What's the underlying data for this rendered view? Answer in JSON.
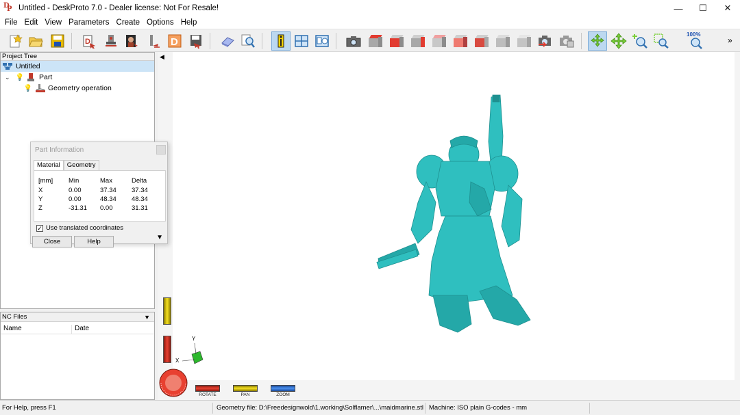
{
  "window": {
    "title": "Untitled - DeskProto 7.0 - Dealer license: Not For Resale!",
    "minimize": "—",
    "maximize": "☐",
    "close": "✕"
  },
  "menu": [
    "File",
    "Edit",
    "View",
    "Parameters",
    "Create",
    "Options",
    "Help"
  ],
  "toolbar": {
    "zoom_label": "100%",
    "overflow": "»"
  },
  "project_tree": {
    "title": "Project Tree",
    "items": [
      {
        "label": "Untitled"
      },
      {
        "label": "Part"
      },
      {
        "label": "Geometry operation"
      }
    ]
  },
  "part_info": {
    "title": "Part Information",
    "tabs": [
      "Material",
      "Geometry"
    ],
    "headers": [
      "[mm]",
      "Min",
      "Max",
      "Delta"
    ],
    "rows": [
      [
        "X",
        "0.00",
        "37.34",
        "37.34"
      ],
      [
        "Y",
        "0.00",
        "48.34",
        "48.34"
      ],
      [
        "Z",
        "-31.31",
        "0.00",
        "31.31"
      ]
    ],
    "checkbox_label": "Use translated coordinates",
    "checked": true,
    "close_button": "Close",
    "help_button": "Help"
  },
  "nc_files": {
    "title": "NC Files",
    "columns": [
      "Name",
      "Date"
    ]
  },
  "viewport": {
    "axis_x": "X",
    "axis_y": "Y",
    "controls": [
      "ROTATE",
      "PAN",
      "ZOOM"
    ],
    "colors": {
      "model": "#2fbfbf",
      "model_dark": "#1f9090",
      "rotate": "#e0312a",
      "pan": "#e8d81a",
      "zoom": "#3a7fe0"
    }
  },
  "status": {
    "help": "For Help, press F1",
    "geometry_file": "Geometry file: D:\\Freedesignwold\\1.working\\Solflamer\\...\\maidmarine.stl",
    "machine": "Machine: ISO plain G-codes - mm"
  }
}
